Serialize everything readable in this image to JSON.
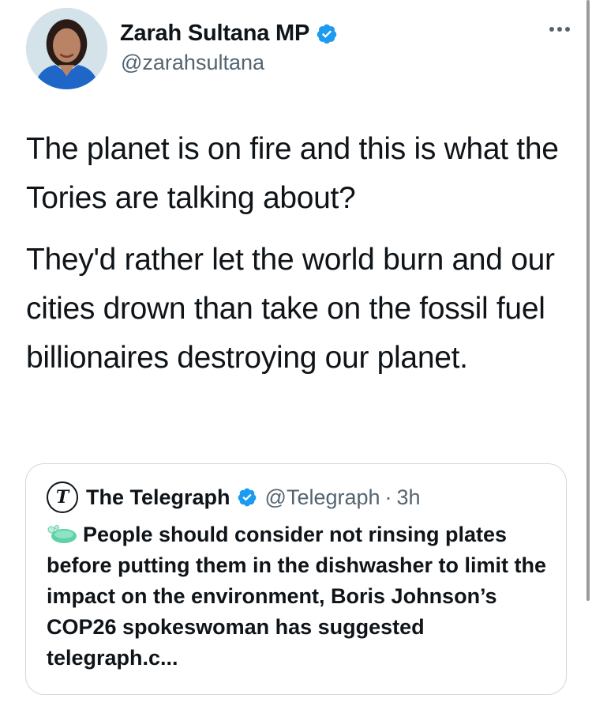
{
  "author": {
    "display_name": "Zarah Sultana MP",
    "handle": "@zarahsultana",
    "verified": true
  },
  "tweet": {
    "paragraphs": [
      "The planet is on fire and this is what the Tories are talking about?",
      "They'd rather let the world burn and our cities drown than take on the fossil fuel billionaires destroying our planet."
    ]
  },
  "quoted": {
    "logo_letter": "T",
    "display_name": "The Telegraph",
    "handle": "@Telegraph",
    "separator": "·",
    "time": "3h",
    "text": "People should consider not rinsing plates before putting them in the dishwasher to limit the impact on the environment, Boris Johnson’s COP26 spokeswoman has suggested telegraph.c..."
  },
  "icons": {
    "verified": "verified-badge-icon",
    "more": "more-options-icon",
    "soap": "soap-icon",
    "logo": "telegraph-logo-icon"
  },
  "colors": {
    "verified_blue": "#1d9bf0",
    "text": "#0f1419",
    "secondary": "#536471",
    "border": "#cfd9de",
    "soap": "#5fd0a8"
  }
}
